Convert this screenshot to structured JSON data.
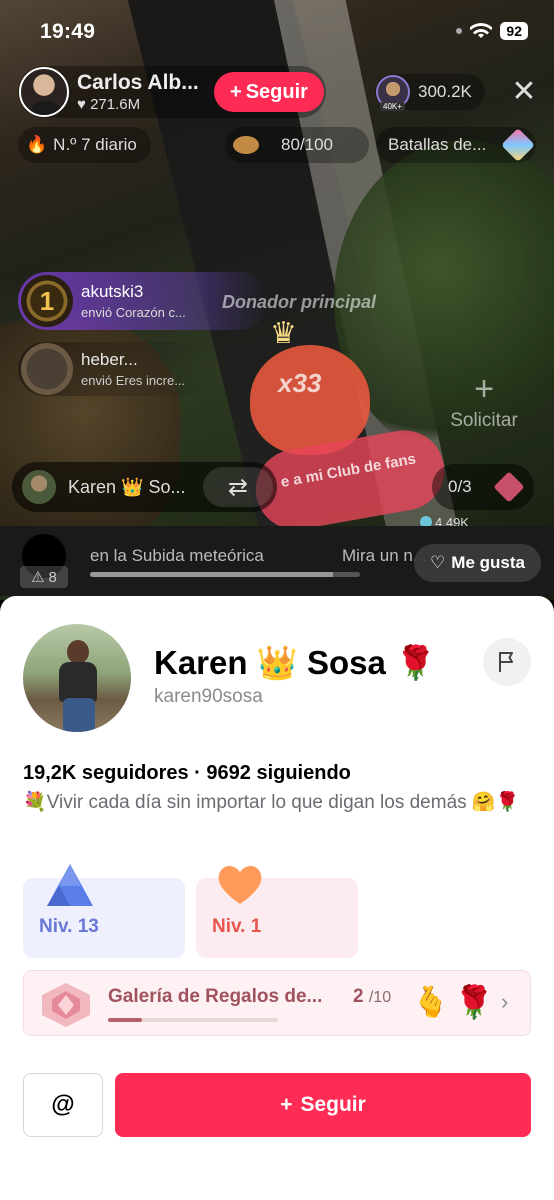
{
  "status_bar": {
    "time": "19:49",
    "battery": "92"
  },
  "live": {
    "host_name": "Carlos Alb...",
    "host_likes": "271.6M",
    "follow_label": "Seguir",
    "viewers": "300.2K",
    "viewer_level": "40K+",
    "rank_label": "N.º 7 diario",
    "goal_label": "80/100",
    "battles_label": "Batallas de...",
    "gift1_user": "akutski3",
    "gift1_msg": "envió Corazón c...",
    "gift1_rank": "1",
    "donor_label": "Donador principal",
    "gift2_user": "heber...",
    "gift2_msg": "envió Eres incre...",
    "combo": "x33",
    "fan_banner": "e a mi Club de fans",
    "request_label": "Solicitar",
    "guest_name": "Karen 👑 So...",
    "counter": "0/3",
    "coins": "4.49K",
    "ticker_text1": "en la Subida meteórica",
    "ticker_text2": "Mira un n...",
    "ticker_progress": 0.9,
    "ticker_badge": "8",
    "like_label": "Me gusta"
  },
  "profile": {
    "name": "Karen 👑 Sosa 🌹",
    "handle": "karen90sosa",
    "stats": "19,2K seguidores · 9692 siguiendo",
    "bio": "💐Vivir cada día sin importar lo que digan los demás 🤗🌹",
    "badge1_label": "Niv. 13",
    "badge2_label": "Niv. 1",
    "gallery_title": "Galería de Regalos de...",
    "gallery_count": "2",
    "gallery_total": "/10",
    "gallery_progress": 0.2,
    "gallery_gift1": "🫰",
    "gallery_gift2": "🌹",
    "mention_label": "@",
    "follow_label": "Seguir"
  },
  "colors": {
    "accent": "#fe2c55",
    "badge_blue": "#6a78d6",
    "badge_pink": "#e8554e"
  }
}
